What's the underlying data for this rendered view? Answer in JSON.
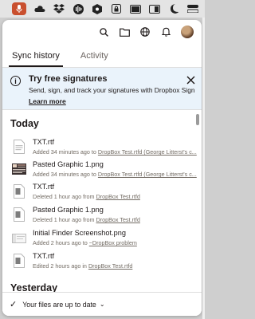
{
  "menubar": {
    "icons": [
      "microphone-icon",
      "cloud-icon",
      "dropbox-icon",
      "waveform-icon",
      "hexagon-icon",
      "lock-icon",
      "display-icon",
      "window-icon",
      "moon-icon",
      "toggle-icon"
    ]
  },
  "toolbar": {
    "icons": [
      "search-icon",
      "folder-icon",
      "globe-icon",
      "bell-icon",
      "avatar"
    ]
  },
  "tabs": [
    {
      "label": "Sync history",
      "active": true
    },
    {
      "label": "Activity",
      "active": false
    }
  ],
  "banner": {
    "title": "Try free signatures",
    "description": "Send, sign, and track your signatures with Dropbox Sign",
    "link": "Learn more"
  },
  "sections": [
    {
      "label": "Today"
    },
    {
      "label": "Yesterday"
    }
  ],
  "items": [
    {
      "name": "TXT.rtf",
      "action": "Added 34 minutes ago to ",
      "location": "DropBox Test.rtfd (George Litterst's c...",
      "thumb": "rtf"
    },
    {
      "name": "Pasted Graphic 1.png",
      "action": "Added 34 minutes ago to ",
      "location": "DropBox Test.rtfd (George Litterst's c...",
      "thumb": "image"
    },
    {
      "name": "TXT.rtf",
      "action": "Deleted 1 hour ago from ",
      "location": "DropBox Test.rtfd",
      "thumb": "rtf"
    },
    {
      "name": "Pasted Graphic 1.png",
      "action": "Deleted 1 hour ago from ",
      "location": "DropBox Test.rtfd",
      "thumb": "png"
    },
    {
      "name": "Initial Finder Screenshot.png",
      "action": "Added 2 hours ago to ",
      "location": "~DropBox problem",
      "thumb": "screenshot"
    },
    {
      "name": "TXT.rtf",
      "action": "Edited 2 hours ago in ",
      "location": "DropBox Test.rtfd",
      "thumb": "rtf"
    }
  ],
  "footer": {
    "status": "Your files are up to date"
  },
  "colors": {
    "banner_bg": "#eaf3fb",
    "text": "#1e1919",
    "meta": "#736c64",
    "mic_accent": "#c94f2e"
  }
}
